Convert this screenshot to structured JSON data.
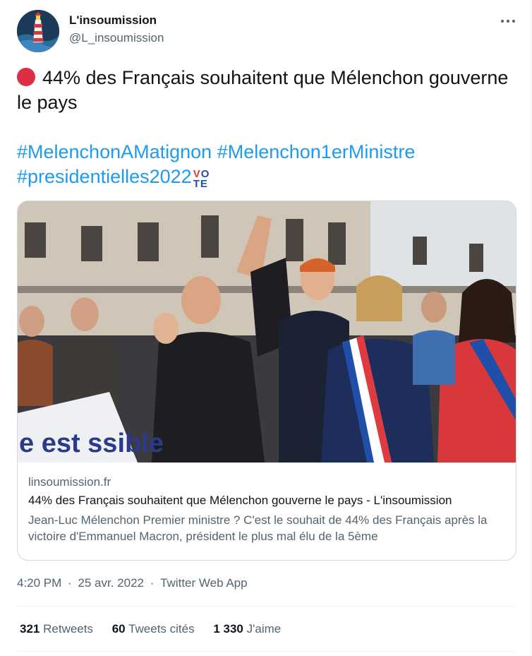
{
  "author": {
    "name": "L'insoumission",
    "handle": "@L_insoumission",
    "avatar_icon": "lighthouse-icon"
  },
  "menu_icon": "more-icon",
  "tweet": {
    "text": "44% des Français souhaitent que Mélenchon gouverne le pays",
    "emoji": "red-circle-icon",
    "hashtags": [
      "#MelenchonAMatignon",
      "#Melenchon1erMinistre",
      "#presidentielles2022"
    ],
    "vote_emoji": "VOTE"
  },
  "card": {
    "image_alt": "photo",
    "domain": "linsoumission.fr",
    "title": "44% des Français souhaitent que Mélenchon gouverne le pays - L'insoumission",
    "description": "Jean-Luc Mélenchon Premier ministre ? C'est le souhait de 44% des Français après la victoire d'Emmanuel Macron, président le plus mal élu de la 5ème",
    "banner_text": "e est  ssible"
  },
  "meta": {
    "time": "4:20 PM",
    "date": "25 avr. 2022",
    "app": "Twitter Web App"
  },
  "stats": {
    "retweets_count": "321",
    "retweets_label": "Retweets",
    "quotes_count": "60",
    "quotes_label": "Tweets cités",
    "likes_count": "1 330",
    "likes_label": "J'aime"
  },
  "colors": {
    "link": "#1d9bf0",
    "secondary": "#536471",
    "primary": "#0f1419"
  }
}
